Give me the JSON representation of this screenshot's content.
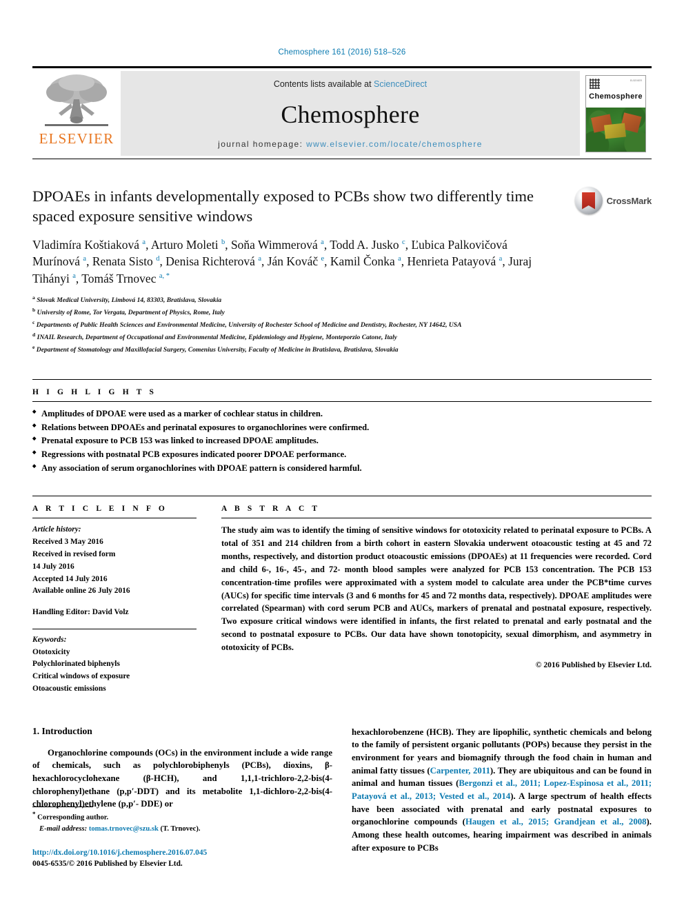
{
  "running_head": "Chemosphere 161 (2016) 518–526",
  "masthead": {
    "publisher_logo_text": "ELSEVIER",
    "contents_prefix": "Contents lists available at ",
    "contents_link": "ScienceDirect",
    "journal_name": "Chemosphere",
    "homepage_prefix": "journal homepage: ",
    "homepage_url": "www.elsevier.com/locate/chemosphere",
    "cover_title": "Chemosphere",
    "cover_corner_text": "ELSEVIER"
  },
  "crossmark": {
    "label": "CrossMark"
  },
  "article": {
    "title": "DPOAEs in infants developmentally exposed to PCBs show two differently time spaced exposure sensitive windows",
    "authors_html": "Vladimíra Koštiaková <sup>a</sup>, Arturo Moleti <sup>b</sup>, Soňa Wimmerová <sup>a</sup>, Todd A. Jusko <sup>c</sup>, Ľubica Palkovičová Murínová <sup>a</sup>, Renata Sisto <sup>d</sup>, Denisa Richterová <sup>a</sup>, Ján Kováč <sup>e</sup>, Kamil Čonka <sup>a</sup>, Henrieta Patayová <sup>a</sup>, Juraj Tihányi <sup>a</sup>, Tomáš Trnovec <sup>a, *</sup>",
    "affiliations": [
      {
        "mark": "a",
        "text": "Slovak Medical University, Limbová 14, 83303, Bratislava, Slovakia"
      },
      {
        "mark": "b",
        "text": "University of Rome, Tor Vergata, Department of Physics, Rome, Italy"
      },
      {
        "mark": "c",
        "text": "Departments of Public Health Sciences and Environmental Medicine, University of Rochester School of Medicine and Dentistry, Rochester, NY 14642, USA"
      },
      {
        "mark": "d",
        "text": "INAIL Research, Department of Occupational and Environmental Medicine, Epidemiology and Hygiene, Monteporzio Catone, Italy"
      },
      {
        "mark": "e",
        "text": "Department of Stomatology and Maxillofacial Surgery, Comenius University, Faculty of Medicine in Bratislava, Bratislava, Slovakia"
      }
    ]
  },
  "highlights": {
    "heading": "H I G H L I G H T S",
    "items": [
      "Amplitudes of DPOAE were used as a marker of cochlear status in children.",
      "Relations between DPOAEs and perinatal exposures to organochlorines were confirmed.",
      "Prenatal exposure to PCB 153 was linked to increased DPOAE amplitudes.",
      "Regressions with postnatal PCB exposures indicated poorer DPOAE performance.",
      "Any association of serum organochlorines with DPOAE pattern is considered harmful."
    ]
  },
  "article_info": {
    "heading": "A R T I C L E   I N F O",
    "history_label": "Article history:",
    "history_lines": [
      "Received 3 May 2016",
      "Received in revised form",
      "14 July 2016",
      "Accepted 14 July 2016",
      "Available online 26 July 2016"
    ],
    "handling_editor": "Handling Editor: David Volz",
    "keywords_label": "Keywords:",
    "keywords": [
      "Ototoxicity",
      "Polychlorinated biphenyls",
      "Critical windows of exposure",
      "Otoacoustic emissions"
    ]
  },
  "abstract": {
    "heading": "A B S T R A C T",
    "text": "The study aim was to identify the timing of sensitive windows for ototoxicity related to perinatal exposure to PCBs. A total of 351 and 214 children from a birth cohort in eastern Slovakia underwent otoacoustic testing at 45 and 72 months, respectively, and distortion product otoacoustic emissions (DPOAEs) at 11 frequencies were recorded. Cord and child 6-, 16-, 45-, and 72- month blood samples were analyzed for PCB 153 concentration. The PCB 153 concentration-time profiles were approximated with a system model to calculate area under the PCB*time curves (AUCs) for specific time intervals (3 and 6 months for 45 and 72 months data, respectively). DPOAE amplitudes were correlated (Spearman) with cord serum PCB and AUCs, markers of prenatal and postnatal exposure, respectively. Two exposure critical windows were identified in infants, the first related to prenatal and early postnatal and the second to postnatal exposure to PCBs. Our data have shown tonotopicity, sexual dimorphism, and asymmetry in ototoxicity of PCBs.",
    "copyright": "© 2016 Published by Elsevier Ltd."
  },
  "introduction": {
    "section_number_title": "1. Introduction",
    "left_paragraph_html": "Organochlorine compounds (OCs) in the environment include a wide range of chemicals, such as polychlorobiphenyls (PCBs), dioxins, β-hexachlorocyclohexane (β-HCH), and 1,1,1-trichloro-2,2-bis(4-chlorophenyl)ethane (p,p′-DDT) and its metabolite 1,1-dichloro-2,2-bis(4-chlorophenyl)ethylene (p,p′- DDE) or",
    "right_paragraph_html": "hexachlorobenzene (HCB). They are lipophilic, synthetic chemicals and belong to the family of persistent organic pollutants (POPs) because they persist in the environment for years and biomagnify through the food chain in human and animal fatty tissues (<span class=\"cite\">Carpenter, 2011</span>). They are ubiquitous and can be found in animal and human tissues (<span class=\"cite\">Bergonzi et al., 2011; Lopez-Espinosa et al., 2011; Patayová et al., 2013; Vested et al., 2014</span>). A large spectrum of health effects have been associated with prenatal and early postnatal exposures to organochlorine compounds (<span class=\"cite\">Haugen et al., 2015; Grandjean et al., 2008</span>). Among these health outcomes, hearing impairment was described in animals after exposure to PCBs"
  },
  "footer": {
    "corresponding_label": "Corresponding author.",
    "email_label": "E-mail address:",
    "email": "tomas.trnovec@szu.sk",
    "email_suffix": "(T. Trnovec).",
    "doi": "http://dx.doi.org/10.1016/j.chemosphere.2016.07.045",
    "issn_line": "0045-6535/© 2016 Published by Elsevier Ltd."
  },
  "colors": {
    "link_blue": "#0b7ab0",
    "elsevier_orange": "#e87722",
    "masthead_gray": "#e6e6e6"
  }
}
